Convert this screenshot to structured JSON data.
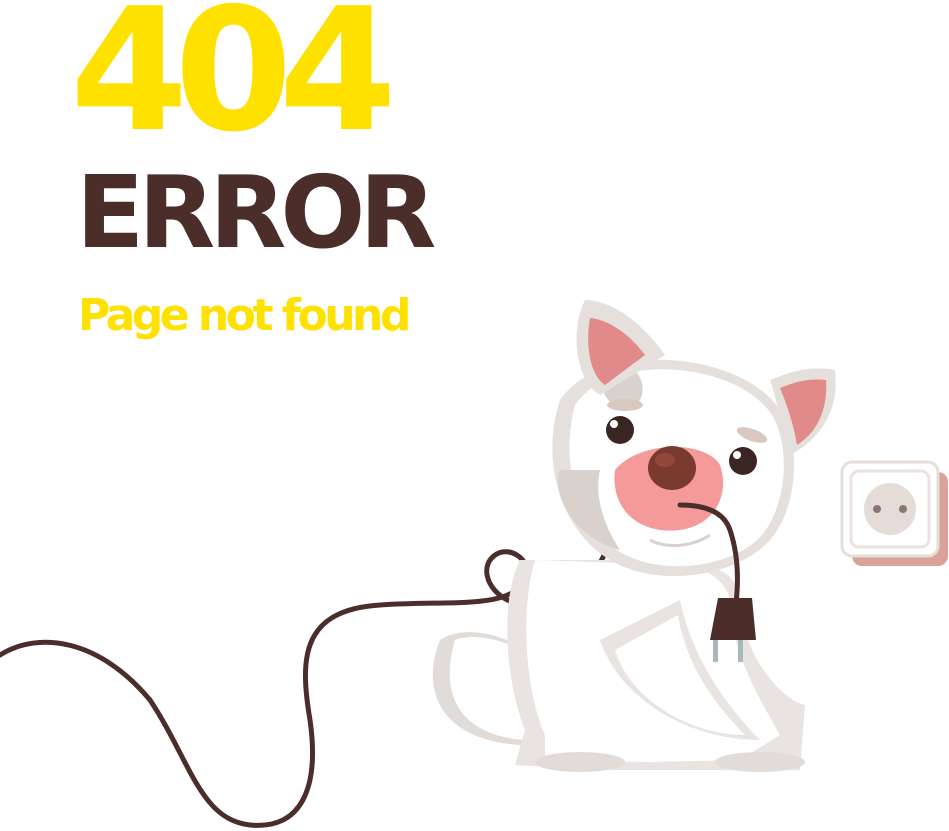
{
  "error": {
    "code": "404",
    "title": "ERROR",
    "message": "Page not found"
  },
  "illustration": {
    "subject": "dog-holding-unplugged-cord",
    "icons": [
      "dog-icon",
      "plug-icon",
      "power-outlet-icon",
      "cable-icon"
    ]
  },
  "colors": {
    "accent_yellow": "#ffe100",
    "dark_brown": "#4b2e2a",
    "nose_pink": "#f59a9a",
    "outlet_shadow": "#d9a39a"
  }
}
